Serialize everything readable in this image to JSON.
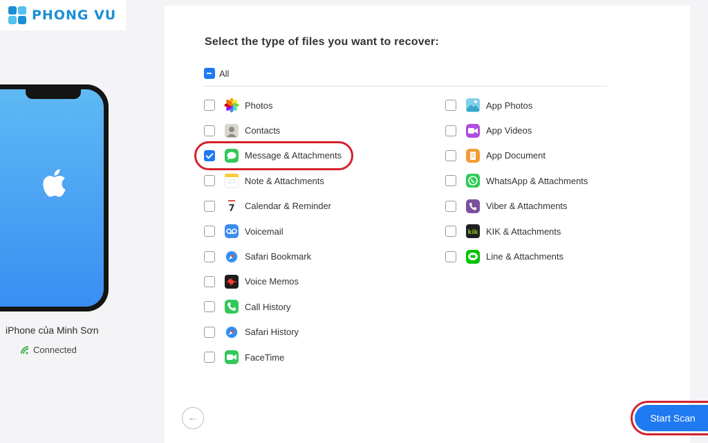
{
  "logo": {
    "text": "PHONG VU"
  },
  "device": {
    "name": "iPhone của Minh Sơn",
    "status": "Connected"
  },
  "main": {
    "title": "Select the type of files you want to recover:",
    "all_label": "All",
    "all_state": "partial"
  },
  "file_types_left": [
    {
      "label": "Photos",
      "icon": "photos-icon",
      "checked": false
    },
    {
      "label": "Contacts",
      "icon": "contacts-icon",
      "checked": false
    },
    {
      "label": "Message & Attachments",
      "icon": "messages-icon",
      "checked": true
    },
    {
      "label": "Note & Attachments",
      "icon": "notes-icon",
      "checked": false
    },
    {
      "label": "Calendar & Reminder",
      "icon": "calendar-icon",
      "checked": false
    },
    {
      "label": "Voicemail",
      "icon": "voicemail-icon",
      "checked": false
    },
    {
      "label": "Safari Bookmark",
      "icon": "safari-icon",
      "checked": false
    },
    {
      "label": "Voice Memos",
      "icon": "voice-memos-icon",
      "checked": false
    },
    {
      "label": "Call History",
      "icon": "phone-icon",
      "checked": false
    },
    {
      "label": "Safari History",
      "icon": "safari-icon",
      "checked": false
    },
    {
      "label": "FaceTime",
      "icon": "facetime-icon",
      "checked": false
    }
  ],
  "file_types_right": [
    {
      "label": "App Photos",
      "icon": "app-photos-icon",
      "checked": false
    },
    {
      "label": "App Videos",
      "icon": "app-videos-icon",
      "checked": false
    },
    {
      "label": "App Document",
      "icon": "app-document-icon",
      "checked": false
    },
    {
      "label": "WhatsApp & Attachments",
      "icon": "whatsapp-icon",
      "checked": false
    },
    {
      "label": "Viber & Attachments",
      "icon": "viber-icon",
      "checked": false
    },
    {
      "label": "KIK & Attachments",
      "icon": "kik-icon",
      "checked": false
    },
    {
      "label": "Line & Attachments",
      "icon": "line-icon",
      "checked": false
    }
  ],
  "calendar_icon_day": "7",
  "kik_icon_text": "kik",
  "actions": {
    "start_scan": "Start Scan"
  },
  "colors": {
    "accent": "#1f7af2",
    "highlight": "#d4222a",
    "brand": "#1b8fd3"
  }
}
